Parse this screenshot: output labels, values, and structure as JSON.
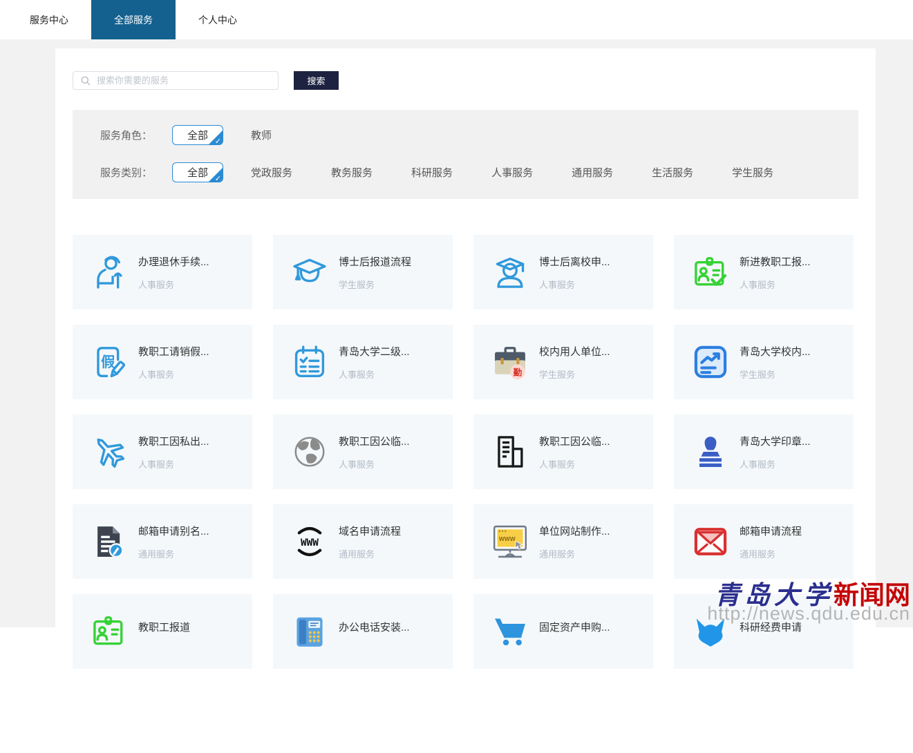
{
  "tabs": [
    {
      "label": "服务中心",
      "active": false
    },
    {
      "label": "全部服务",
      "active": true
    },
    {
      "label": "个人中心",
      "active": false
    }
  ],
  "search": {
    "placeholder": "搜索你需要的服务",
    "button": "搜索"
  },
  "filters": [
    {
      "label": "服务角色：",
      "options": [
        {
          "label": "全部",
          "selected": true
        },
        {
          "label": "教师",
          "selected": false
        }
      ]
    },
    {
      "label": "服务类别：",
      "options": [
        {
          "label": "全部",
          "selected": true
        },
        {
          "label": "党政服务",
          "selected": false
        },
        {
          "label": "教务服务",
          "selected": false
        },
        {
          "label": "科研服务",
          "selected": false
        },
        {
          "label": "人事服务",
          "selected": false
        },
        {
          "label": "通用服务",
          "selected": false
        },
        {
          "label": "生活服务",
          "selected": false
        },
        {
          "label": "学生服务",
          "selected": false
        }
      ]
    }
  ],
  "cards": [
    {
      "title": "办理退休手续...",
      "category": "人事服务",
      "icon": "retiree-icon"
    },
    {
      "title": "博士后报道流程",
      "category": "学生服务",
      "icon": "graduation-cap-icon"
    },
    {
      "title": "博士后离校申...",
      "category": "人事服务",
      "icon": "graduate-icon"
    },
    {
      "title": "新进教职工报...",
      "category": "人事服务",
      "icon": "id-card-check-icon"
    },
    {
      "title": "教职工请销假...",
      "category": "人事服务",
      "icon": "leave-form-icon"
    },
    {
      "title": "青岛大学二级...",
      "category": "人事服务",
      "icon": "checklist-icon"
    },
    {
      "title": "校内用人单位...",
      "category": "学生服务",
      "icon": "briefcase-badge-icon"
    },
    {
      "title": "青岛大学校内...",
      "category": "学生服务",
      "icon": "trend-chart-icon"
    },
    {
      "title": "教职工因私出...",
      "category": "人事服务",
      "icon": "airplane-icon"
    },
    {
      "title": "教职工因公临...",
      "category": "人事服务",
      "icon": "globe-icon"
    },
    {
      "title": "教职工因公临...",
      "category": "人事服务",
      "icon": "building-icon"
    },
    {
      "title": "青岛大学印章...",
      "category": "人事服务",
      "icon": "stamp-icon"
    },
    {
      "title": "邮箱申请别名...",
      "category": "通用服务",
      "icon": "document-edit-icon"
    },
    {
      "title": "域名申请流程",
      "category": "通用服务",
      "icon": "www-icon"
    },
    {
      "title": "单位网站制作...",
      "category": "通用服务",
      "icon": "website-monitor-icon"
    },
    {
      "title": "邮箱申请流程",
      "category": "通用服务",
      "icon": "envelope-icon"
    },
    {
      "title": "教职工报道",
      "category": "",
      "icon": "id-card-green-icon"
    },
    {
      "title": "办公电话安装...",
      "category": "",
      "icon": "phone-icon"
    },
    {
      "title": "固定资产申购...",
      "category": "",
      "icon": "cart-icon"
    },
    {
      "title": "科研经费申请",
      "category": "",
      "icon": "research-fund-icon"
    }
  ],
  "icon_glyphs": {
    "leave_char": "假",
    "duty_badge": "勤",
    "www_text": "WWW",
    "check_mark": "✓"
  },
  "watermark": {
    "site_name_prefix": "青岛大学",
    "site_name_suffix": "新闻网",
    "url": "http://news.qdu.edu.cn"
  },
  "colors": {
    "tab_active_bg": "#14618f",
    "search_button_bg": "#1d2240",
    "accent_blue": "#3099db",
    "selected_chip_border": "#2a8ad2",
    "card_bg": "#f4f8fb",
    "icon_green": "#35d235",
    "icon_red": "#d93030",
    "stamp_blue": "#3a5ec4",
    "watermark_blue": "#2b2f8e",
    "watermark_red": "#c40505"
  }
}
